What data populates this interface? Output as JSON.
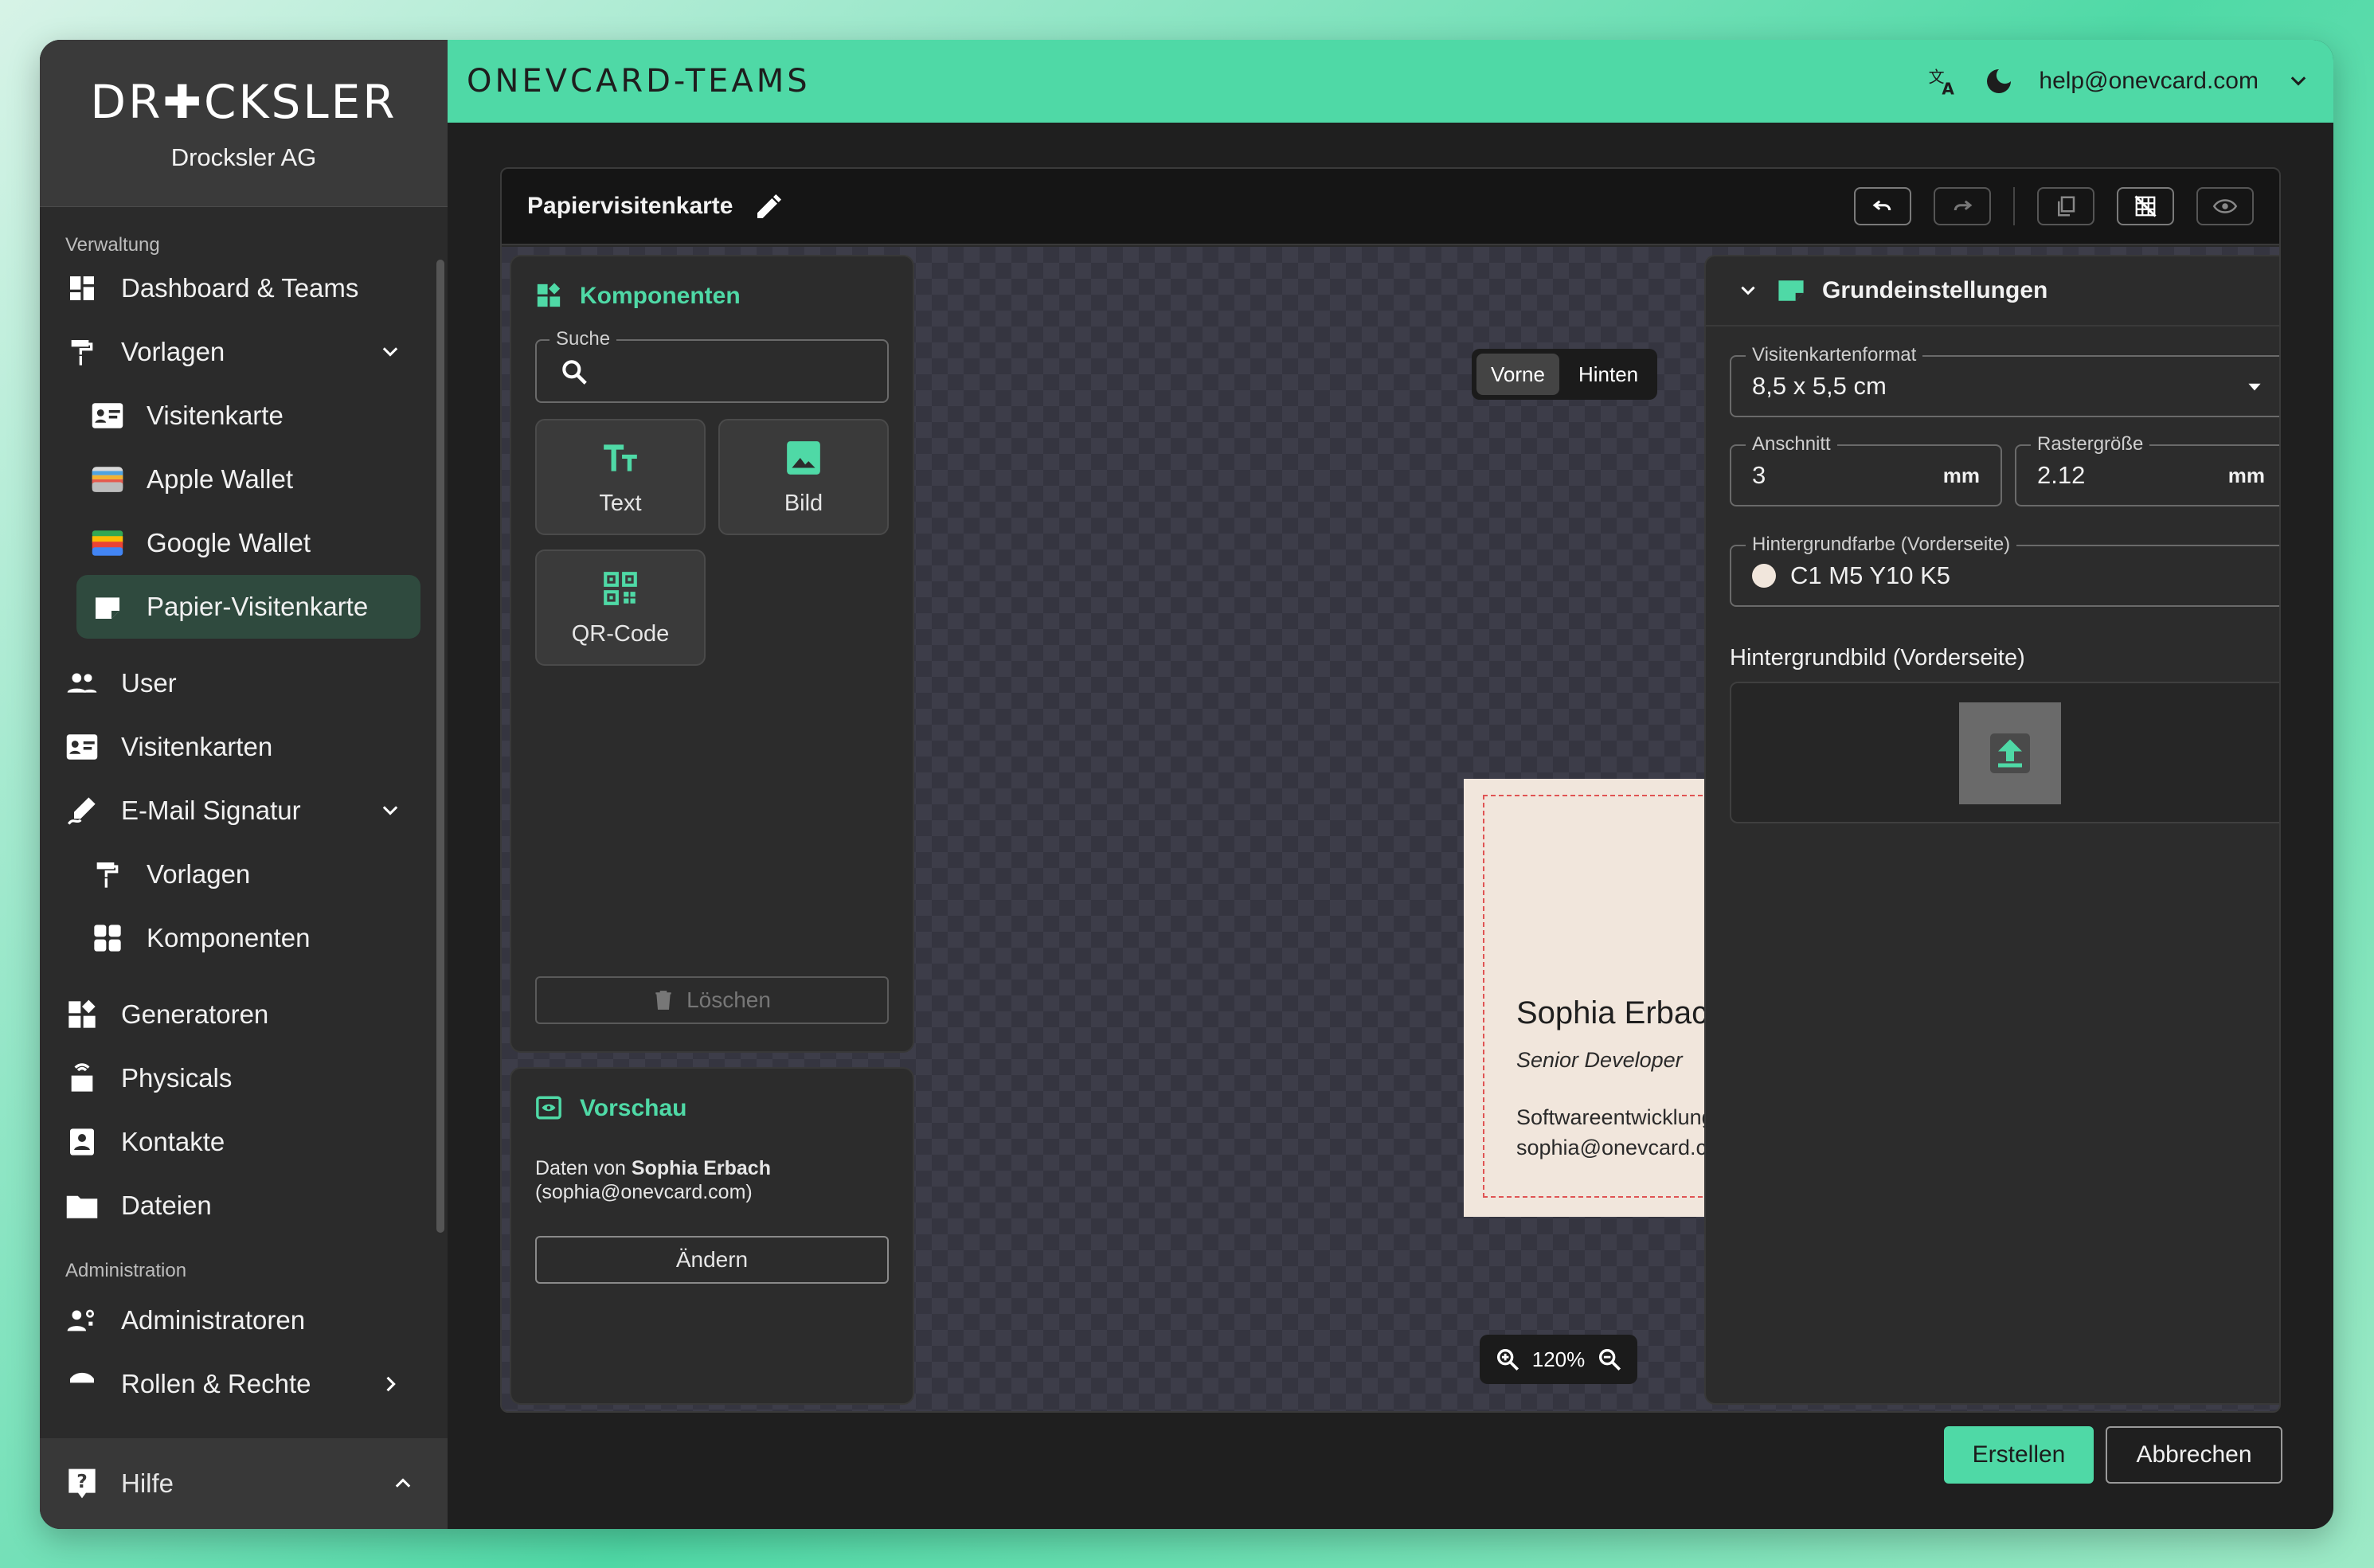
{
  "brand": {
    "logo_text": "DR✚CKSLER",
    "company_name": "Drocksler AG"
  },
  "topbar": {
    "title": "ONEVCARD-TEAMS",
    "account_email": "help@onevcard.com"
  },
  "sidebar": {
    "section_admin_label": "Verwaltung",
    "items": [
      {
        "label": "Dashboard & Teams"
      },
      {
        "label": "Vorlagen"
      },
      {
        "label": "Visitenkarte"
      },
      {
        "label": "Apple Wallet"
      },
      {
        "label": "Google Wallet"
      },
      {
        "label": "Papier-Visitenkarte"
      },
      {
        "label": "User"
      },
      {
        "label": "Visitenkarten"
      },
      {
        "label": "E-Mail Signatur"
      },
      {
        "label": "Vorlagen"
      },
      {
        "label": "Komponenten"
      },
      {
        "label": "Generatoren"
      },
      {
        "label": "Physicals"
      },
      {
        "label": "Kontakte"
      },
      {
        "label": "Dateien"
      }
    ],
    "section_administration_label": "Administration",
    "admin_items": [
      {
        "label": "Administratoren"
      },
      {
        "label": "Rollen & Rechte"
      }
    ],
    "help_label": "Hilfe"
  },
  "editor": {
    "title": "Papiervisitenkarte",
    "components": {
      "title": "Komponenten",
      "search_label": "Suche",
      "search_value": "",
      "tiles": [
        "Text",
        "Bild",
        "QR-Code"
      ],
      "delete_label": "Löschen"
    },
    "preview": {
      "title": "Vorschau",
      "data_prefix": "Daten von",
      "person_name": "Sophia Erbach",
      "person_email": "(sophia@onevcard.com)",
      "change_label": "Ändern"
    },
    "side_toggle": {
      "front": "Vorne",
      "back": "Hinten"
    },
    "zoom_level": "120%",
    "card": {
      "name": "Sophia Erbach",
      "role": "Senior Developer",
      "department": "Softwareentwicklung",
      "email": "sophia@onevcard.com"
    },
    "settings": {
      "title": "Grundeinstellungen",
      "format_label": "Visitenkartenformat",
      "format_value": "8,5 x 5,5 cm",
      "bleed_label": "Anschnitt",
      "bleed_value": "3",
      "bleed_unit": "mm",
      "grid_label": "Rastergröße",
      "grid_value": "2.12",
      "grid_unit": "mm",
      "bg_color_label": "Hintergrundfarbe (Vorderseite)",
      "bg_color_value": "C1 M5 Y10 K5",
      "bg_image_label": "Hintergrundbild (Vorderseite)"
    }
  },
  "actions": {
    "create": "Erstellen",
    "cancel": "Abbrechen"
  },
  "colors": {
    "accent": "#4fd9a6",
    "card_background": "#f1e6dc",
    "bleed_line": "#e05454"
  }
}
